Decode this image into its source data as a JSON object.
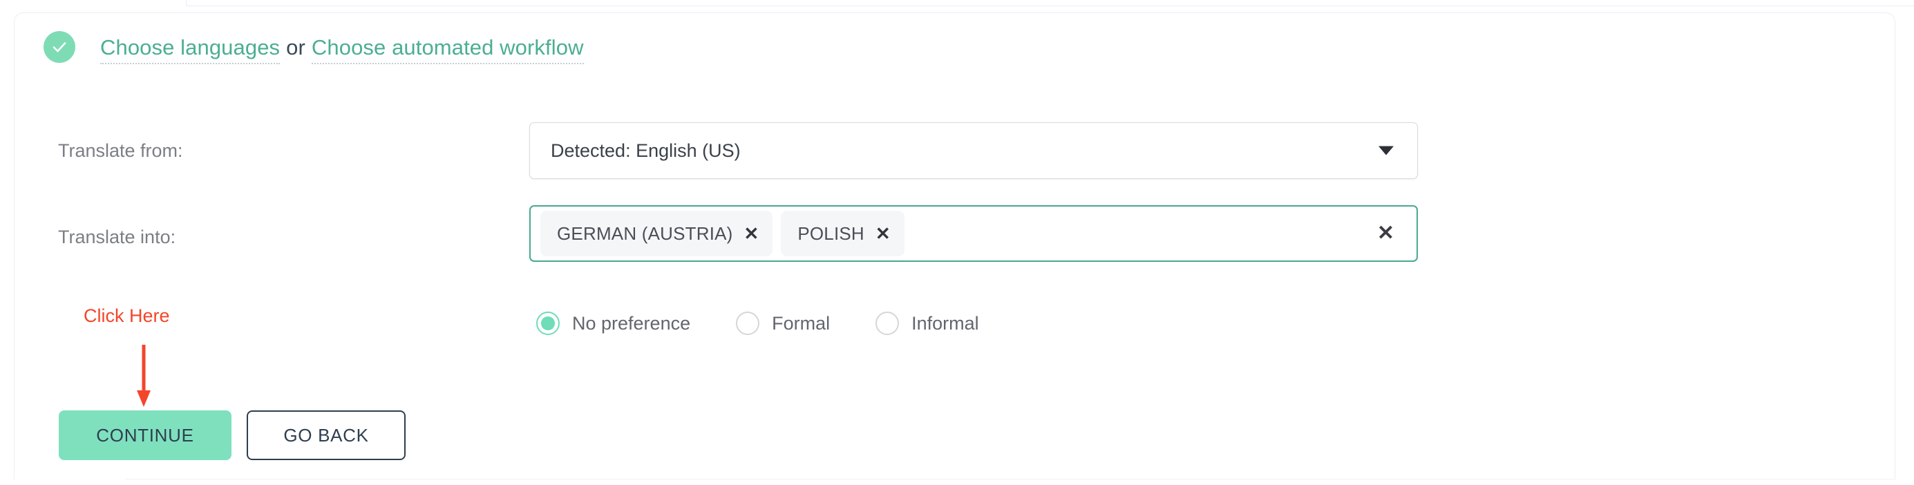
{
  "header": {
    "status_icon": "check-circle-icon",
    "link_languages": "Choose languages",
    "separator": "or",
    "link_workflow": "Choose automated workflow"
  },
  "form": {
    "label_from": "Translate from:",
    "label_into": "Translate into:",
    "source_language": {
      "value": "Detected: English (US)",
      "caret_icon": "chevron-down-icon"
    },
    "target_languages": {
      "tags": [
        {
          "label": "GERMAN (AUSTRIA)",
          "remove_icon": "✕"
        },
        {
          "label": "POLISH",
          "remove_icon": "✕"
        }
      ],
      "clear_all_icon": "✕"
    },
    "formality": {
      "options": [
        {
          "label": "No preference",
          "selected": true
        },
        {
          "label": "Formal",
          "selected": false
        },
        {
          "label": "Informal",
          "selected": false
        }
      ]
    }
  },
  "annotation": {
    "text": "Click Here",
    "arrow_icon": "arrow-down-icon"
  },
  "actions": {
    "continue_label": "CONTINUE",
    "go_back_label": "GO BACK"
  },
  "colors": {
    "mint": "#7FE0BE",
    "teal": "#4BAE93",
    "navy": "#2E3E4F",
    "annotation_red": "#F4452A",
    "tag_bg": "#F5F6F8",
    "border_light": "#ECEEF4"
  }
}
